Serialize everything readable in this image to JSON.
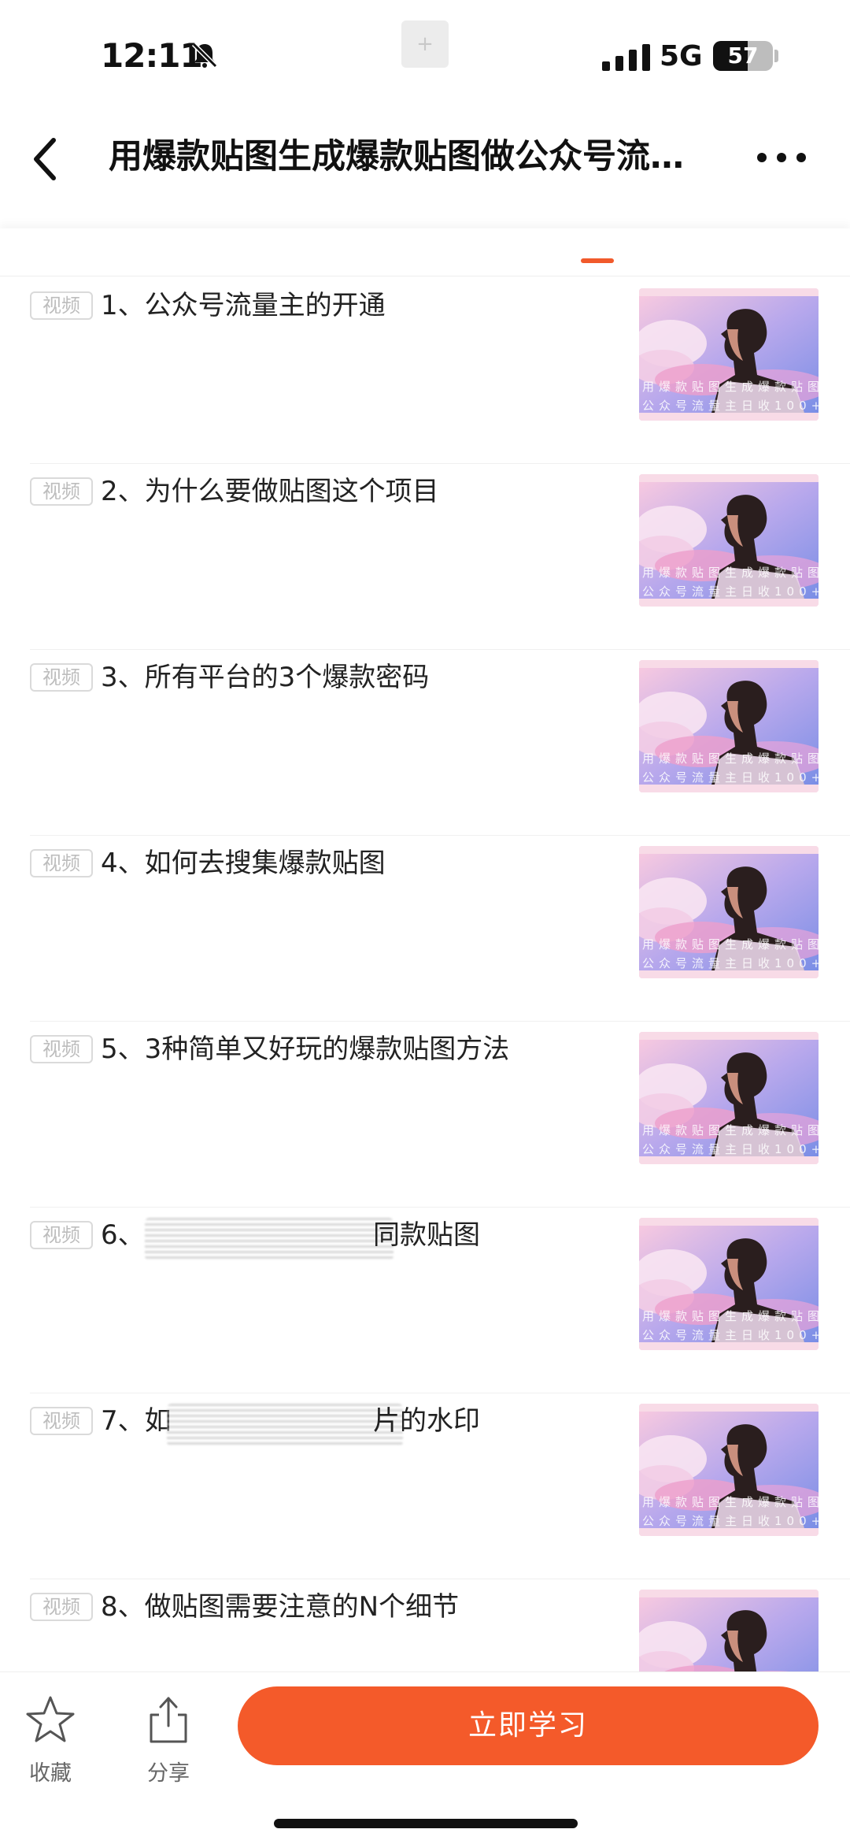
{
  "status_bar": {
    "time": "12:11",
    "network": "5G",
    "battery": "57",
    "notch_button": "+"
  },
  "nav": {
    "title": "用爆款贴图生成爆款贴图做公众号流…"
  },
  "tabs": {
    "active_color": "#f15a2b"
  },
  "lessons": [
    {
      "badge": "视频",
      "title": "1、公众号流量主的开通"
    },
    {
      "badge": "视频",
      "title": "2、为什么要做贴图这个项目"
    },
    {
      "badge": "视频",
      "title": "3、所有平台的3个爆款密码"
    },
    {
      "badge": "视频",
      "title": "4、如何去搜集爆款贴图"
    },
    {
      "badge": "视频",
      "title": "5、3种简单又好玩的爆款贴图方法"
    },
    {
      "badge": "视频",
      "title_start": "6、",
      "title_end": "同款贴图"
    },
    {
      "badge": "视频",
      "title_start": "7、如",
      "title_end": "片的水印"
    },
    {
      "badge": "视频",
      "title": "8、做贴图需要注意的N个细节"
    }
  ],
  "thumbnail": {
    "line1": "用爆款贴图生成爆款贴图",
    "line2": "公众号流量主日收100+"
  },
  "bottom_bar": {
    "favorite_label": "收藏",
    "share_label": "分享",
    "study_label": "立即学习",
    "accent": "#f45a2a"
  }
}
